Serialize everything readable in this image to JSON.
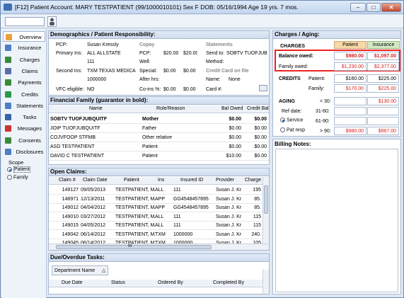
{
  "window": {
    "title": "[F12] Patient Account: MARY TESTPATIENT (99/1000010101)  Sex F  DOB: 05/16/1994  Age 19 yrs. 7 mos."
  },
  "nav": [
    {
      "label": "Overview",
      "icon": "folder-icon"
    },
    {
      "label": "Insurance",
      "icon": "insurance-card-icon"
    },
    {
      "label": "Charges",
      "icon": "charges-icon"
    },
    {
      "label": "Claims",
      "icon": "claims-icon"
    },
    {
      "label": "Payments",
      "icon": "payments-icon"
    },
    {
      "label": "Credits",
      "icon": "credits-icon"
    },
    {
      "label": "Statements",
      "icon": "statements-icon"
    },
    {
      "label": "Tasks",
      "icon": "tasks-icon"
    },
    {
      "label": "Messages",
      "icon": "messages-icon"
    },
    {
      "label": "Consents",
      "icon": "consents-icon"
    },
    {
      "label": "Disclosures",
      "icon": "disclosures-icon"
    }
  ],
  "scope": {
    "label": "Scope",
    "options": [
      "Patient",
      "Family"
    ],
    "selected": "Patient"
  },
  "demographics": {
    "title": "Demographics / Patient Responsibility:",
    "pcp_label": "PCP:",
    "pcp_value": "Susan Kressly",
    "primary_label": "Primary Ins:",
    "primary_value": "ALL ALLSTATE",
    "primary_id": "111",
    "second_label": "Second Ins:",
    "second_value": "TXM TEXAS MEDICA",
    "second_id": "1000000",
    "vfc_label": "VFC eligible:",
    "vfc_value": "NO",
    "copay_title": "Copay",
    "pcp2_label": "PCP:",
    "pcp2_a": "$20.00",
    "pcp2_b": "$20.00",
    "well_label": "Well:",
    "special_label": "Special:",
    "special_a": "$0.00",
    "special_b": "$0.00",
    "afterhrs_label": "After hrs:",
    "coins_label": "Co-ins %:",
    "coins_a": "$0.00",
    "coins_b": "$0.00",
    "statements_title": "Statements",
    "sendto_label": "Send to:",
    "sendto_value": "SOBTV TUOFJUBQ",
    "method_label": "Method:",
    "cc_title": "Credit Card on file",
    "name_label": "Name:",
    "name_value": "None",
    "card_label": "Card #:"
  },
  "family": {
    "title": "Financial Family (guarantor in bold):",
    "columns": [
      "Name",
      "Role/Reason",
      "Bal Owed",
      "Credit Bal"
    ],
    "rows": [
      {
        "name": "SOBTV TUOFJUBQUITF",
        "role": "Mother",
        "bal": "$0.00",
        "credit": "$0.00",
        "bold": true
      },
      {
        "name": "JOIP TUOFJUBQUITF",
        "role": "Father",
        "bal": "$0.00",
        "credit": "$0.00",
        "bold": false
      },
      {
        "name": "COJVFOOP STFMB",
        "role": "Other relative",
        "bal": "$0.00",
        "credit": "$0.00",
        "bold": false
      },
      {
        "name": "ASD TESTPATIENT",
        "role": "Patient",
        "bal": "$0.00",
        "credit": "$0.00",
        "bold": false
      },
      {
        "name": "DAVID C TESTPATIENT",
        "role": "Patient",
        "bal": "$10.00",
        "credit": "$0.00",
        "bold": false
      }
    ]
  },
  "claims": {
    "title": "Open Claims:",
    "columns": [
      "Claim #",
      "Claim Date",
      "Patient",
      "Ins",
      "Insured ID",
      "Provider",
      "Charge"
    ],
    "rows": [
      [
        "149127",
        "09/05/2013",
        "TESTPATIENT, MA",
        "ALL",
        "111",
        "Susan J. Kr",
        "195"
      ],
      [
        "148971",
        "12/13/2011",
        "TESTPATIENT, MA",
        "APP",
        "GG4548457895",
        "Susan J. Kr",
        "85."
      ],
      [
        "149012",
        "04/04/2012",
        "TESTPATIENT, MA",
        "APP",
        "GG4548457895",
        "Susan J. Kr",
        "85."
      ],
      [
        "149010",
        "03/27/2012",
        "TESTPATIENT, MA",
        "ALL",
        "111",
        "Susan J. Kr",
        "115"
      ],
      [
        "149015",
        "04/05/2012",
        "TESTPATIENT, MA",
        "ALL",
        "111",
        "Susan J. Kr",
        "115"
      ],
      [
        "149042",
        "06/14/2012",
        "TESTPATIENT, MA",
        "TXM",
        "1000000",
        "Susan J. Kr",
        "240."
      ],
      [
        "149045",
        "06/14/2012",
        "TESTPATIENT, MA",
        "TXM",
        "1000000",
        "Susan J. Kr",
        "105"
      ]
    ],
    "scroll_mid": "III"
  },
  "tasks": {
    "title": "Due/Overdue Tasks:",
    "group_label": "Department Name",
    "columns": [
      "Due Date",
      "Status",
      "Ordered By",
      "Completed By"
    ]
  },
  "charges": {
    "title": "Charges / Aging:",
    "col_patient": "Patient",
    "col_insurance": "Insurance",
    "charges_label": "CHARGES",
    "balance_label": "Balance owed:",
    "balance_patient": "$980.00",
    "balance_ins": "$1,097.00",
    "family_owed_label": "Family owed:",
    "family_patient": "$1,230.00",
    "family_ins": "$2,377.00",
    "credits_label": "CREDITS",
    "credits_patient_label": "Patient:",
    "credits_patient_a": "$160.00",
    "credits_patient_b": "$225.00",
    "credits_family_label": "Family:",
    "credits_family_a": "$170.00",
    "credits_family_b": "$225.00",
    "aging_label": "AGING",
    "lt30": "< 30:",
    "lt30_ins": "$130.00",
    "refdate_label": "Ref date:",
    "b31": "31-60:",
    "service_label": "Service",
    "b61": "61-90:",
    "patresp_label": "Pat resp",
    "gt90": "> 90:",
    "gt90_patient": "$980.00",
    "gt90_ins": "$967.00",
    "colors": {
      "patient_header": "#f7d9a6",
      "insurance_header": "#d3e8c4",
      "red": "#d62121"
    }
  },
  "billing": {
    "title": "Billing Notes:"
  }
}
